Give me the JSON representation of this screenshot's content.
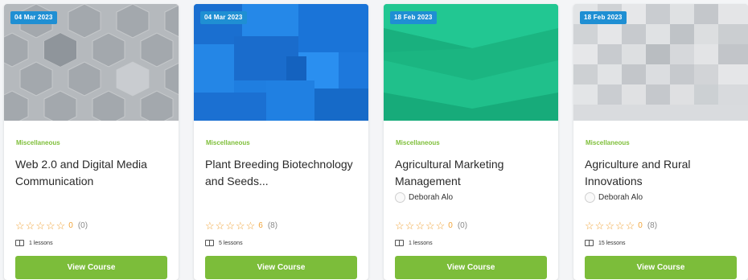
{
  "courses": [
    {
      "date": "04 Mar 2023",
      "category": "Miscellaneous",
      "title": "Web 2.0 and Digital Media Communication",
      "instructor": "",
      "rating_score": "0",
      "rating_count": "(0)",
      "lessons": "1 lessons",
      "button_label": "View Course",
      "thumb_color": "#a8adb2"
    },
    {
      "date": "04 Mar 2023",
      "category": "Miscellaneous",
      "title": "Plant Breeding Biotechnology and Seeds...",
      "instructor": "",
      "rating_score": "6",
      "rating_count": "(8)",
      "lessons": "5 lessons",
      "button_label": "View Course",
      "thumb_color": "#1f7ee0"
    },
    {
      "date": "18 Feb 2023",
      "category": "Miscellaneous",
      "title": "Agricultural Marketing Management",
      "instructor": "Deborah Alo",
      "rating_score": "0",
      "rating_count": "(0)",
      "lessons": "1 lessons",
      "button_label": "View Course",
      "thumb_color": "#1fbf8a"
    },
    {
      "date": "18 Feb 2023",
      "category": "Miscellaneous",
      "title": "Agriculture and Rural Innovations",
      "instructor": "Deborah Alo",
      "rating_score": "0",
      "rating_count": "(8)",
      "lessons": "15 lessons",
      "button_label": "View Course",
      "thumb_color": "#d5d7da"
    }
  ],
  "colors": {
    "badge": "#1f8fd3",
    "category": "#7fbf3a",
    "star": "#f0a43a",
    "button": "#7cbd3a"
  },
  "icons": {
    "star": "star-icon",
    "lessons": "book-icon",
    "instructor": "avatar-icon"
  }
}
